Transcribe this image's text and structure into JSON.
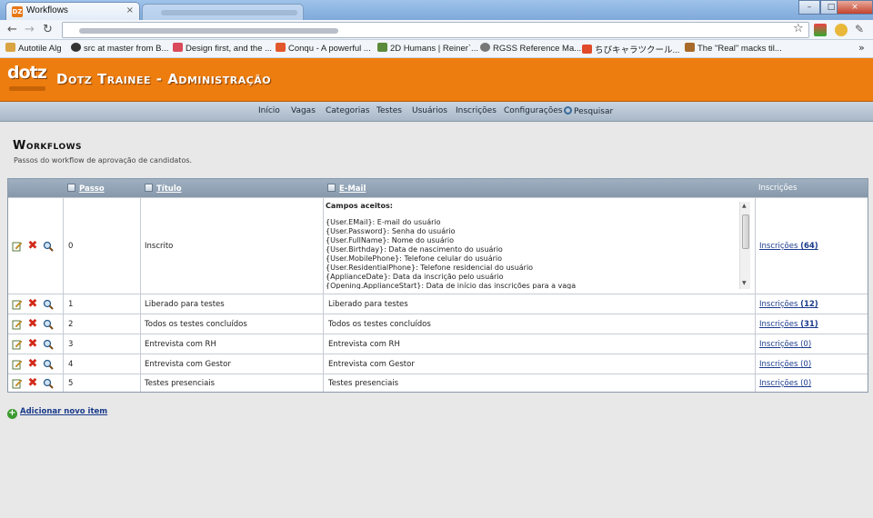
{
  "browser": {
    "tab_title": "Workflows",
    "tab_close": "×",
    "tab_fav": "DZ",
    "bookmarks": [
      {
        "label": "Autotile Alg",
        "color": "#d9a441"
      },
      {
        "label": "src at master from B...",
        "color": "#333333"
      },
      {
        "label": "Design first, and the ...",
        "color": "#d94a5a"
      },
      {
        "label": "Conqu - A powerful ...",
        "color": "#e2572b"
      },
      {
        "label": "2D Humans | Reiner`...",
        "color": "#5a8a3a"
      },
      {
        "label": "RGSS Reference Ma...",
        "color": "#777777"
      },
      {
        "label": "ちびキャラツクール...",
        "color": "#e04a2a"
      },
      {
        "label": "The \"Real\" macks til...",
        "color": "#a86a2a"
      }
    ],
    "bookmarks_more": "»"
  },
  "app": {
    "logo": "dotz",
    "title": "Dotz Trainee - Administração"
  },
  "menu": [
    "Início",
    "Vagas",
    "Categorias",
    "Testes",
    "Usuários",
    "Inscrições",
    "Configurações",
    "Pesquisar"
  ],
  "page": {
    "title": "Workflows",
    "subtitle": "Passos do workflow de aprovação de candidatos."
  },
  "table": {
    "headers": {
      "passo": "Passo",
      "titulo": "Título",
      "email": "E-Mail",
      "inscricoes": "Inscrições"
    },
    "email_box": {
      "heading": "Campos aceitos:",
      "lines": [
        "{User.EMail}: E-mail do usuário",
        "{User.Password}: Senha do usuário",
        "{User.FullName}: Nome do usuário",
        "{User.Birthday}: Data de nascimento do usuário",
        "{User.MobilePhone}: Telefone celular do usuário",
        "{User.ResidentialPhone}: Telefone residencial do usuário",
        "{ApplianceDate}: Data da inscrição pelo usuário",
        "{Opening.ApplianceStart}: Data de início das inscrições para a vaga"
      ]
    },
    "rows": [
      {
        "passo": "0",
        "titulo": "Inscrito",
        "email": "",
        "insc_label": "Inscrições",
        "insc_count": "(64)",
        "bold": true
      },
      {
        "passo": "1",
        "titulo": "Liberado para testes",
        "email": "Liberado para testes",
        "insc_label": "Inscrições",
        "insc_count": "(12)",
        "bold": true
      },
      {
        "passo": "2",
        "titulo": "Todos os testes concluídos",
        "email": "Todos os testes concluídos",
        "insc_label": "Inscrições",
        "insc_count": "(31)",
        "bold": true
      },
      {
        "passo": "3",
        "titulo": "Entrevista com RH",
        "email": "Entrevista com RH",
        "insc_label": "Inscrições",
        "insc_count": "(0)",
        "bold": false
      },
      {
        "passo": "4",
        "titulo": "Entrevista com Gestor",
        "email": "Entrevista com Gestor",
        "insc_label": "Inscrições",
        "insc_count": "(0)",
        "bold": false
      },
      {
        "passo": "5",
        "titulo": "Testes presenciais",
        "email": "Testes presenciais",
        "insc_label": "Inscrições",
        "insc_count": "(0)",
        "bold": false
      }
    ]
  },
  "add_item": "Adicionar novo item",
  "colors": {
    "brand_orange": "#ee7d0f",
    "link": "#1a3a8a",
    "delete_red": "#d12a1a"
  }
}
